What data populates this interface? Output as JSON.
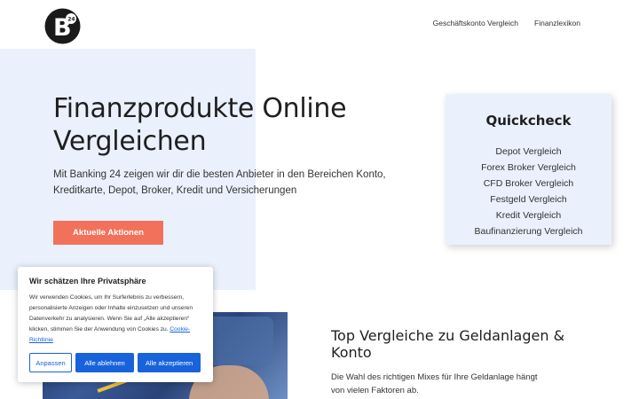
{
  "logo": {
    "text": "B",
    "badge": "24",
    "icon": "banking24-logo"
  },
  "nav": {
    "items": [
      "Geschäftskonto Vergleich",
      "Finanzlexikon"
    ]
  },
  "hero": {
    "title": "Finanzprodukte Online Vergleichen",
    "subtitle": "Mit Banking 24 zeigen wir dir die besten Anbieter in den Bereichen Konto, Kreditkarte, Depot, Broker, Kredit und Versicherungen",
    "cta_label": "Aktuelle Aktionen"
  },
  "quickcheck": {
    "title": "Quickcheck",
    "items": [
      "Depot Vergleich",
      "Forex Broker Vergleich",
      "CFD Broker Vergleich",
      "Festgeld Vergleich",
      "Kredit Vergleich",
      "Baufinanzierung Vergleich"
    ]
  },
  "section": {
    "title": "Top Vergleiche zu Geldanlagen & Konto",
    "text": "Die Wahl des richtigen Mixes für Ihre Geldanlage hängt von vielen Faktoren ab."
  },
  "cookie": {
    "title": "Wir schätzen Ihre Privatsphäre",
    "body": "Wir verwenden Cookies, um Ihr Surferlebnis zu verbessern, personalisierte Anzeigen oder Inhalte einzusetzen und unseren Datenverkehr zu analysieren. Wenn Sie auf „Alle akzeptieren“ klicken, stimmen Sie der Anwendung von Cookies zu.",
    "link": "Cookie-Richtlinie",
    "buttons": {
      "customize": "Anpassen",
      "reject": "Alle ablehnen",
      "accept": "Alle akzeptieren"
    }
  },
  "colors": {
    "hero_bg": "#eaf1fc",
    "cta": "#f2715a",
    "cookie_accent": "#1863dc"
  }
}
